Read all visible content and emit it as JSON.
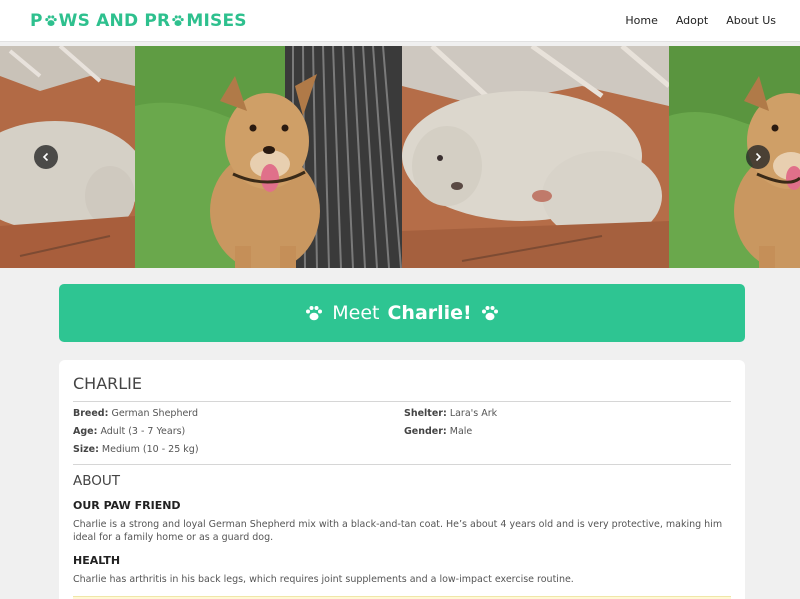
{
  "brand": {
    "name_before": "P",
    "name_after": "WS AND PR",
    "name_tail": "MISES"
  },
  "nav": {
    "items": [
      "Home",
      "Adopt",
      "About Us"
    ]
  },
  "carousel": {
    "prev_icon": "chevron-left-icon",
    "next_icon": "chevron-right-icon"
  },
  "meet": {
    "prefix": "Meet",
    "name": "Charlie!"
  },
  "pet": {
    "name": "CHARLIE",
    "details": {
      "breed_label": "Breed:",
      "breed": "German Shepherd",
      "shelter_label": "Shelter:",
      "shelter": "Lara's Ark",
      "age_label": "Age:",
      "age": "Adult (3 - 7 Years)",
      "gender_label": "Gender:",
      "gender": "Male",
      "size_label": "Size:",
      "size": "Medium (10 - 25 kg)"
    }
  },
  "about": {
    "heading": "ABOUT",
    "paw_friend_heading": "OUR PAW FRIEND",
    "paw_friend_text": "Charlie is a strong and loyal German Shepherd mix with a black-and-tan coat. He’s about 4 years old and is very protective, making him ideal for a family home or as a guard dog.",
    "health_heading": "HEALTH",
    "health_text": "Charlie has arthritis in his back legs, which requires joint supplements and a low-impact exercise routine."
  },
  "colors": {
    "accent": "#2ec592",
    "brand": "#2ec08e"
  }
}
